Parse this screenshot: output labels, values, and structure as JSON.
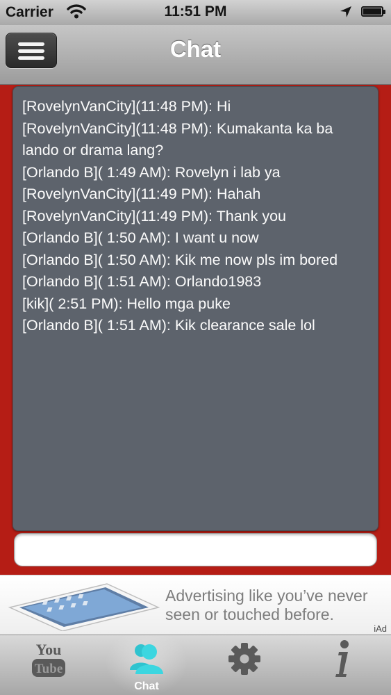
{
  "status_bar": {
    "carrier": "Carrier",
    "time": "11:51 PM",
    "battery_level": 1.0
  },
  "nav_bar": {
    "title": "Chat",
    "menu_icon": "hamburger-menu-icon"
  },
  "chat": {
    "messages": [
      "[RovelynVanCity](11:48  PM): Hi",
      "[RovelynVanCity](11:48  PM): Kumakanta ka ba lando or drama lang?",
      "[Orlando B]( 1:49  AM): Rovelyn i lab ya",
      "[RovelynVanCity](11:49  PM): Hahah",
      "[RovelynVanCity](11:49  PM): Thank you",
      "[Orlando B]( 1:50  AM): I want u now",
      "[Orlando B]( 1:50  AM): Kik me now pls im bored",
      "[Orlando B]( 1:51  AM): Orlando1983",
      "[kik]( 2:51  PM): Hello mga puke",
      "[Orlando B]( 1:51  AM): Kik clearance sale lol"
    ],
    "input_value": "",
    "input_placeholder": ""
  },
  "ad": {
    "text": "Advertising like you’ve never seen or touched before.",
    "label": "iAd",
    "image_icon": "tablet-image"
  },
  "tab_bar": {
    "tabs": [
      {
        "label": "",
        "icon": "youtube-icon",
        "active": false
      },
      {
        "label": "Chat",
        "icon": "people-icon",
        "active": true
      },
      {
        "label": "",
        "icon": "gear-icon",
        "active": false
      },
      {
        "label": "",
        "icon": "info-icon",
        "active": false
      }
    ],
    "active_color": "#3cd6e0"
  },
  "colors": {
    "background": "#b51d15",
    "chat_panel": "#5d636c",
    "nav_bar": "#b4b4b4"
  }
}
